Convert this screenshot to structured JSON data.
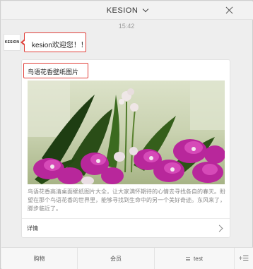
{
  "header": {
    "title": "KESION",
    "dropdown_icon": "chevron-down-icon",
    "close_icon": "close-icon"
  },
  "conversation": {
    "timestamp": "15:42",
    "avatar_text": "KESION",
    "message_text": "kesion欢迎您！！"
  },
  "article": {
    "title": "鸟语花香壁纸图片",
    "image_description": "purple orchids",
    "description": "鸟语花香高清桌面壁纸图片大全，让大家满怀期待的心情去寻找各自的春天。盼望在那个鸟语花香的世界里，能够寻找到生命中的另一个美好奇迹。东风来了，脚步临近了。",
    "link_label": "详情",
    "link_icon": "chevron-right-icon"
  },
  "menu": {
    "items": [
      {
        "label": "购物"
      },
      {
        "label": "会员"
      },
      {
        "label": "test",
        "icon": "menu-list-icon"
      }
    ],
    "toggle_label": "+☰",
    "toggle_icon": "keyboard-toggle-icon"
  },
  "colors": {
    "highlight_border": "#e0403a",
    "background": "#eeeeee",
    "card_background": "#ffffff"
  }
}
